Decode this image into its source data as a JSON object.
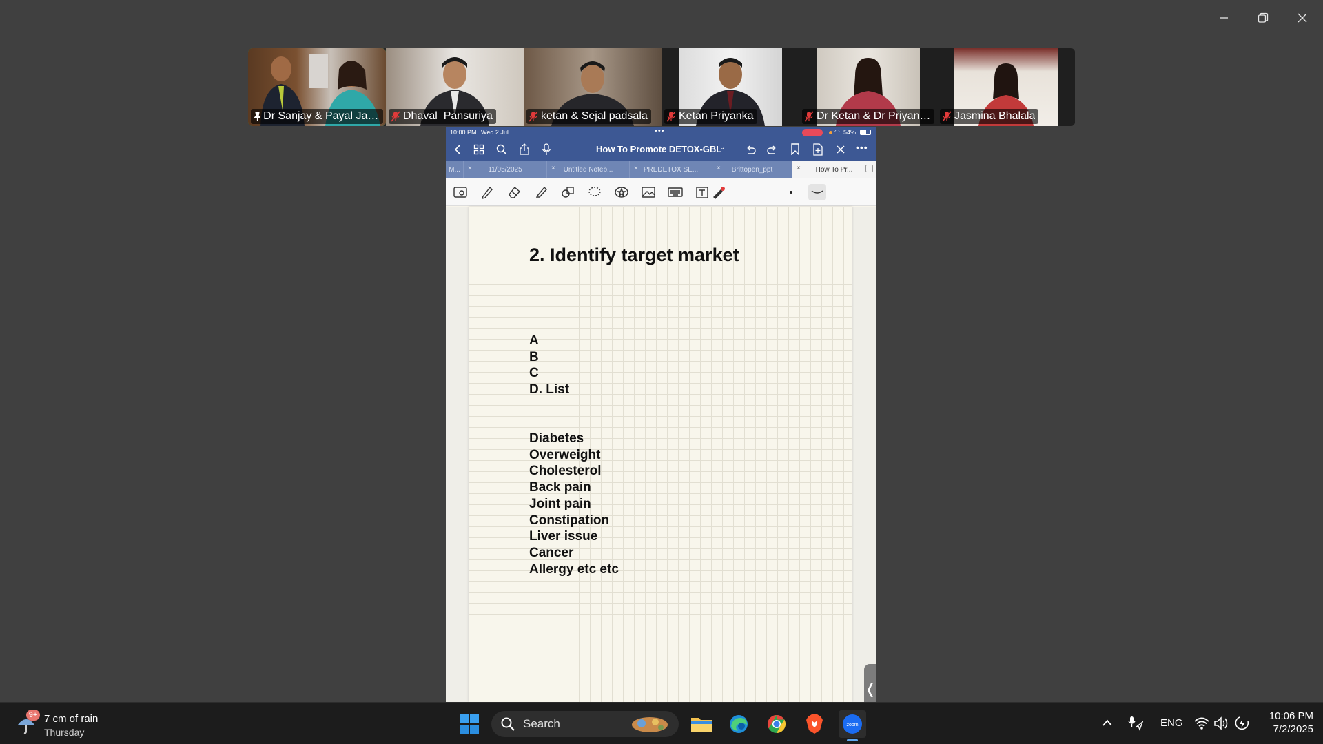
{
  "window": {
    "controls": [
      "minimize",
      "restore",
      "close"
    ]
  },
  "participants": [
    {
      "name": "Dr Sanjay & Payal Jasa...",
      "pinned": true,
      "active": true
    },
    {
      "name": "Dhaval_Pansuriya",
      "muted": true
    },
    {
      "name": "ketan & Sejal padsala",
      "muted": true
    },
    {
      "name": "Ketan Priyanka",
      "muted": true
    },
    {
      "name": "Dr Ketan & Dr Priyank...",
      "muted": true
    },
    {
      "name": "Jasmina Bhalala",
      "muted": true
    }
  ],
  "ipad": {
    "status": {
      "time": "10:00 PM",
      "date": "Wed 2 Jul",
      "battery": "54%"
    },
    "doc_title": "How To Promote DETOX-GBL",
    "tabs": [
      "M...",
      "11/05/2025",
      "Untitled Noteb...",
      "PREDETOX SE...",
      "Brittopen_ppt",
      "How To Pr..."
    ],
    "heading": "2. Identify target market",
    "list_letters": [
      "A",
      "B",
      "C",
      "D.  List"
    ],
    "conditions": [
      "Diabetes",
      "Overweight",
      "Cholesterol",
      "Back pain",
      "Joint pain",
      "Constipation",
      "Liver issue",
      "Cancer",
      "Allergy etc etc"
    ]
  },
  "taskbar": {
    "weather": {
      "badge": "9+",
      "line1": "7 cm of rain",
      "line2": "Thursday"
    },
    "search_label": "Search",
    "language": "ENG",
    "time": "10:06 PM",
    "date": "7/2/2025"
  },
  "colors": {
    "active_speaker": "#2fd27a",
    "ipad_bar": "#3d5894",
    "zoom_blue": "#1b6cf2"
  }
}
